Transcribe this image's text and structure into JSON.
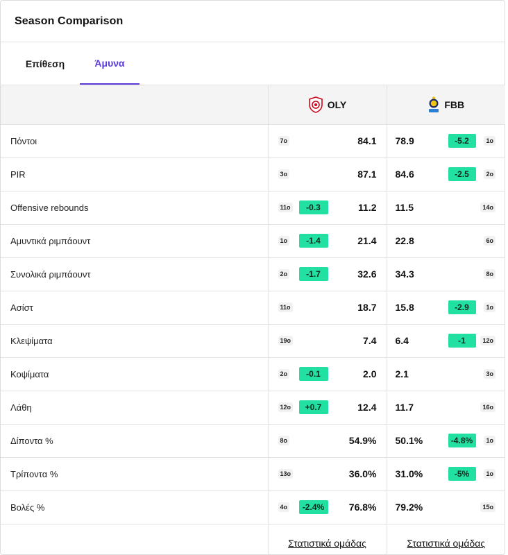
{
  "header": {
    "title": "Season Comparison"
  },
  "tabs": [
    {
      "label": "Επίθεση",
      "active": false
    },
    {
      "label": "Άμυνα",
      "active": true
    }
  ],
  "teams": {
    "home": {
      "code": "OLY",
      "logo": "olympiacos-logo-icon"
    },
    "away": {
      "code": "FBB",
      "logo": "fenerbahce-logo-icon"
    }
  },
  "colors": {
    "accent": "#5b3ad8",
    "diff_badge": "#22e0a1"
  },
  "rows": [
    {
      "stat": "Πόντοι",
      "home": {
        "rank": "7ο",
        "diff": "",
        "value": "84.1"
      },
      "away": {
        "value": "78.9",
        "diff": "-5.2",
        "rank": "1ο"
      }
    },
    {
      "stat": "PIR",
      "home": {
        "rank": "3ο",
        "diff": "",
        "value": "87.1"
      },
      "away": {
        "value": "84.6",
        "diff": "-2.5",
        "rank": "2ο"
      }
    },
    {
      "stat": "Offensive rebounds",
      "home": {
        "rank": "11ο",
        "diff": "-0.3",
        "value": "11.2"
      },
      "away": {
        "value": "11.5",
        "diff": "",
        "rank": "14ο"
      }
    },
    {
      "stat": "Αμυντικά ριμπάουντ",
      "home": {
        "rank": "1ο",
        "diff": "-1.4",
        "value": "21.4"
      },
      "away": {
        "value": "22.8",
        "diff": "",
        "rank": "6ο"
      }
    },
    {
      "stat": "Συνολικά ριμπάουντ",
      "home": {
        "rank": "2ο",
        "diff": "-1.7",
        "value": "32.6"
      },
      "away": {
        "value": "34.3",
        "diff": "",
        "rank": "8ο"
      }
    },
    {
      "stat": "Ασίστ",
      "home": {
        "rank": "11ο",
        "diff": "",
        "value": "18.7"
      },
      "away": {
        "value": "15.8",
        "diff": "-2.9",
        "rank": "1ο"
      }
    },
    {
      "stat": "Κλεψίματα",
      "home": {
        "rank": "19ο",
        "diff": "",
        "value": "7.4"
      },
      "away": {
        "value": "6.4",
        "diff": "-1",
        "rank": "12ο"
      }
    },
    {
      "stat": "Κοψίματα",
      "home": {
        "rank": "2ο",
        "diff": "-0.1",
        "value": "2.0"
      },
      "away": {
        "value": "2.1",
        "diff": "",
        "rank": "3ο"
      }
    },
    {
      "stat": "Λάθη",
      "home": {
        "rank": "12ο",
        "diff": "+0.7",
        "value": "12.4"
      },
      "away": {
        "value": "11.7",
        "diff": "",
        "rank": "16ο"
      }
    },
    {
      "stat": "Δίποντα %",
      "home": {
        "rank": "8ο",
        "diff": "",
        "value": "54.9%"
      },
      "away": {
        "value": "50.1%",
        "diff": "-4.8%",
        "rank": "1ο"
      }
    },
    {
      "stat": "Τρίποντα %",
      "home": {
        "rank": "13ο",
        "diff": "",
        "value": "36.0%"
      },
      "away": {
        "value": "31.0%",
        "diff": "-5%",
        "rank": "1ο"
      }
    },
    {
      "stat": "Βολές %",
      "home": {
        "rank": "4ο",
        "diff": "-2.4%",
        "value": "76.8%"
      },
      "away": {
        "value": "79.2%",
        "diff": "",
        "rank": "15ο"
      }
    }
  ],
  "footer": {
    "home_link": "Στατιστικά ομάδας",
    "away_link": "Στατιστικά ομάδας"
  }
}
